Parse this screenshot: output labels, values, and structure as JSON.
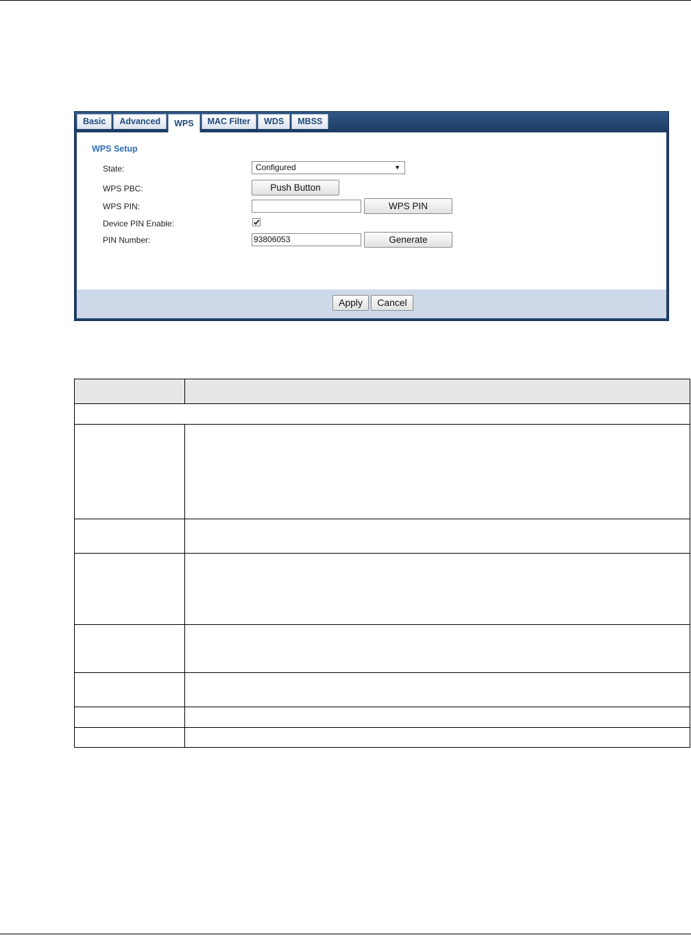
{
  "tabs": [
    {
      "label": "Basic"
    },
    {
      "label": "Advanced"
    },
    {
      "label": "WPS"
    },
    {
      "label": "MAC Filter"
    },
    {
      "label": "WDS"
    },
    {
      "label": "MBSS"
    }
  ],
  "active_tab": "WPS",
  "wps_setup": {
    "title": "WPS Setup",
    "state_label": "State:",
    "state_value": "Configured",
    "pbc_label": "WPS PBC:",
    "push_button_label": "Push Button",
    "pin_label": "WPS PIN:",
    "pin_value": "",
    "wps_pin_button_label": "WPS PIN",
    "device_pin_label": "Device PIN Enable:",
    "device_pin_checked": true,
    "pin_number_label": "PIN Number:",
    "pin_number_value": "93806053",
    "generate_button_label": "Generate"
  },
  "footer": {
    "apply_label": "Apply",
    "cancel_label": "Cancel"
  },
  "colors": {
    "tab_bar": "#1f3f68",
    "section_title": "#2f6cb1",
    "footer_bg": "#cdd9e8",
    "table_header_bg": "#e7e7e7"
  }
}
